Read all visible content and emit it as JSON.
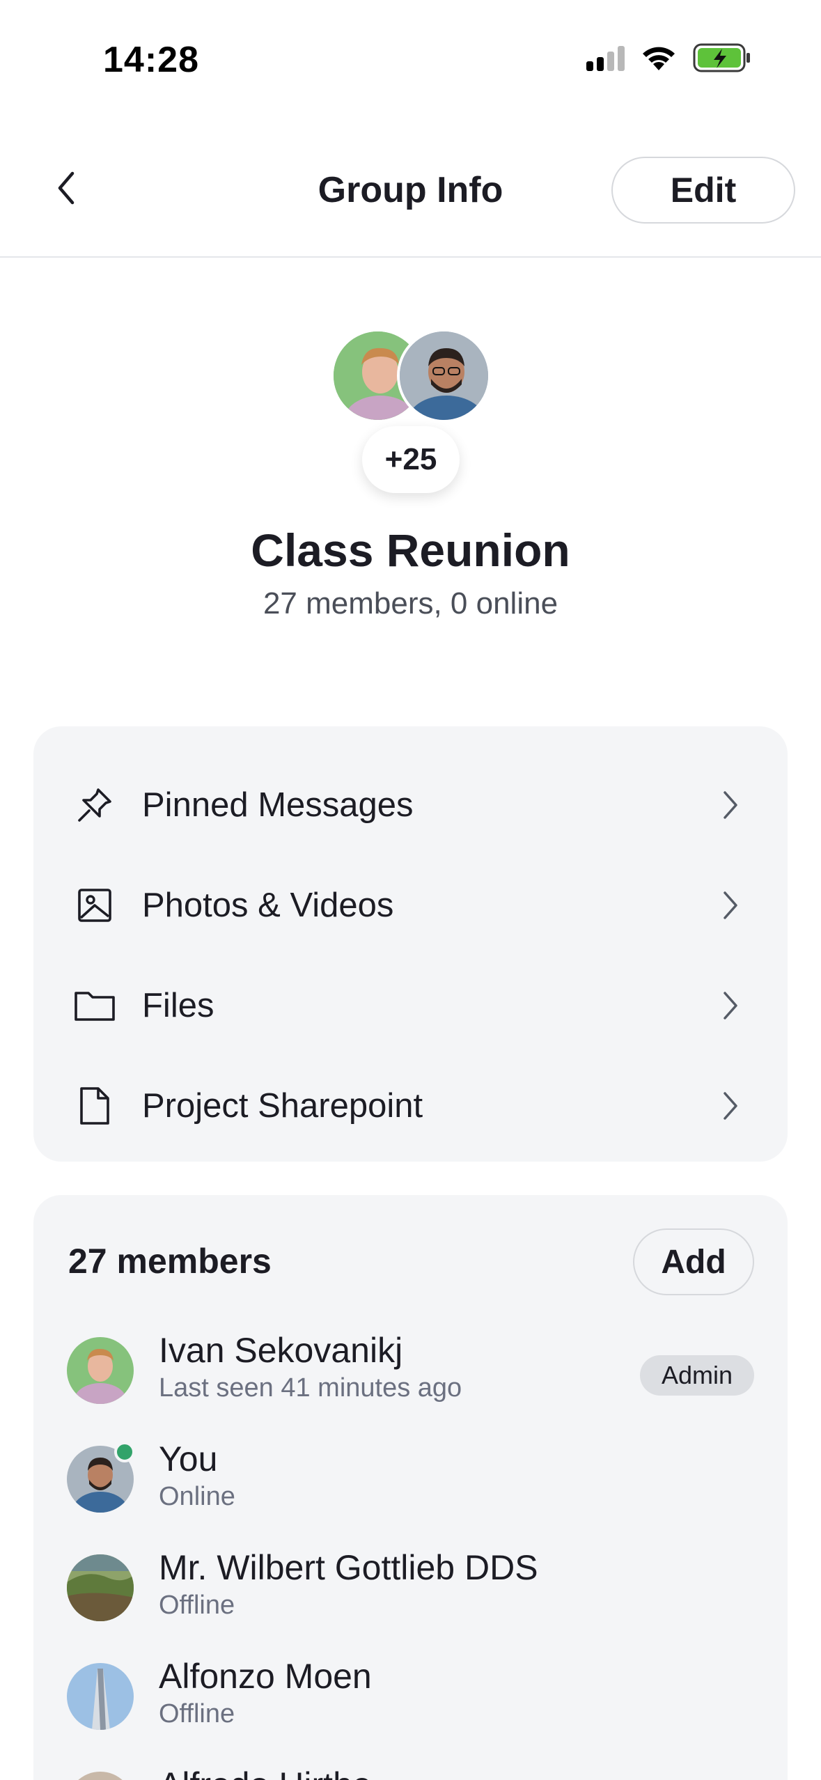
{
  "status_bar": {
    "time": "14:28"
  },
  "nav": {
    "title": "Group Info",
    "edit_label": "Edit"
  },
  "group": {
    "name": "Class Reunion",
    "meta": "27 members, 0 online",
    "more_count": "+25"
  },
  "menu": [
    {
      "label": "Pinned Messages",
      "icon": "pin-icon"
    },
    {
      "label": "Photos & Videos",
      "icon": "image-icon"
    },
    {
      "label": "Files",
      "icon": "folder-icon"
    },
    {
      "label": "Project Sharepoint",
      "icon": "document-icon"
    }
  ],
  "members": {
    "title": "27 members",
    "add_label": "Add",
    "list": [
      {
        "name": "Ivan Sekovanikj",
        "status": "Last seen 41 minutes ago",
        "badge": "Admin"
      },
      {
        "name": "You",
        "status": "Online"
      },
      {
        "name": "Mr. Wilbert Gottlieb DDS",
        "status": "Offline"
      },
      {
        "name": "Alfonzo Moen",
        "status": "Offline"
      },
      {
        "name": "Alfredo Hirthe",
        "status": ""
      }
    ]
  },
  "colors": {
    "online": "#32a36a",
    "card_bg": "#f4f5f7",
    "text": "#1c1c24",
    "muted": "#6b7080"
  }
}
